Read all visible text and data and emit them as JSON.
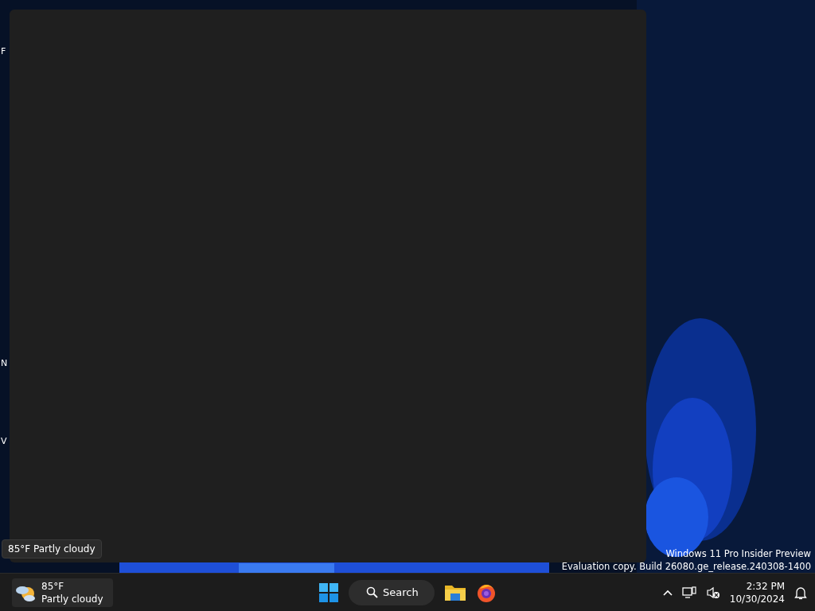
{
  "desktop": {
    "icon_labels": [
      "F",
      "N",
      "V"
    ],
    "watermark": [
      "Windows 11 Pro Insider Preview",
      "Evaluation copy. Build 26080.ge_release.240308-1400"
    ]
  },
  "blank_window": {
    "kind": "empty"
  },
  "tooltip": {
    "text": "85°F Partly cloudy"
  },
  "taskbar": {
    "weather": {
      "temperature": "85°F",
      "condition": "Partly cloudy"
    },
    "search": {
      "label": "Search"
    },
    "clock": {
      "time": "2:32 PM",
      "date": "10/30/2024"
    },
    "sound_muted": true
  }
}
